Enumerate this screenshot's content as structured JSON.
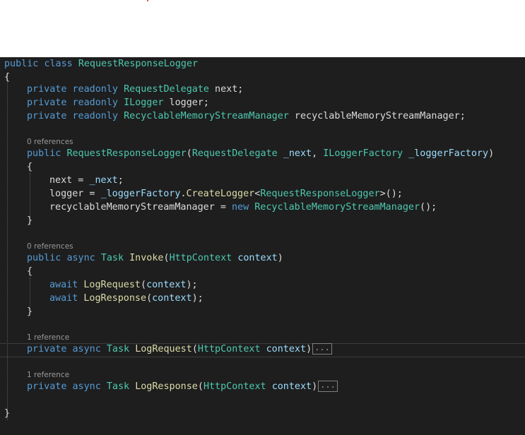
{
  "code": {
    "class_decl": {
      "kw1": "public",
      "kw2": "class",
      "name": "RequestResponseLogger"
    },
    "brace_open": "{",
    "brace_close": "}",
    "field1": {
      "kw1": "private",
      "kw2": "readonly",
      "type": "RequestDelegate",
      "rest": " next;"
    },
    "field2": {
      "kw1": "private",
      "kw2": "readonly",
      "type": "ILogger",
      "rest": " logger;"
    },
    "field3": {
      "kw1": "private",
      "kw2": "readonly",
      "type": "RecyclableMemoryStreamManager",
      "rest": " recyclableMemoryStreamManager;"
    },
    "ctor": {
      "refs": "0 references",
      "kw1": "public",
      "name": "RequestResponseLogger",
      "p1_type": "RequestDelegate",
      "p1_name": "_next",
      "p2_type": "ILoggerFactory",
      "p2_name": "_loggerFactory",
      "brace_open": "{",
      "brace_close": "}",
      "line1_left": "next = ",
      "line1_var": "_next",
      "line1_end": ";",
      "line2_left": "logger = ",
      "line2_var": "_loggerFactory",
      "line2_dot": ".",
      "line2_method": "CreateLogger",
      "line2_lt": "<",
      "line2_type": "RequestResponseLogger",
      "line2_end": ">();",
      "line3_left": "recyclableMemoryStreamManager = ",
      "line3_new": "new",
      "line3_type": "RecyclableMemoryStreamManager",
      "line3_end": "();"
    },
    "invoke": {
      "refs": "0 references",
      "kw1": "public",
      "kw2": "async",
      "ret_type": "Task",
      "name": "Invoke",
      "p_type": "HttpContext",
      "p_name": "context",
      "brace_open": "{",
      "brace_close": "}",
      "await1": "await",
      "call1": "LogRequest",
      "arg1": "context",
      "await2": "await",
      "call2": "LogResponse",
      "arg2": "context"
    },
    "log_request": {
      "refs": "1 reference",
      "kw1": "private",
      "kw2": "async",
      "ret_type": "Task",
      "name": "LogRequest",
      "p_type": "HttpContext",
      "p_name": "context",
      "fold": "..."
    },
    "log_response": {
      "refs": "1 reference",
      "kw1": "private",
      "kw2": "async",
      "ret_type": "Task",
      "name": "LogResponse",
      "p_type": "HttpContext",
      "p_name": "context",
      "fold": "..."
    }
  },
  "colors": {
    "background": "#1e1e1e",
    "keyword": "#569cd6",
    "type": "#4ec9b0",
    "method": "#dcdcaa",
    "parameter": "#9cdcfe",
    "plain": "#dcdcdc",
    "codelens": "#999999"
  }
}
